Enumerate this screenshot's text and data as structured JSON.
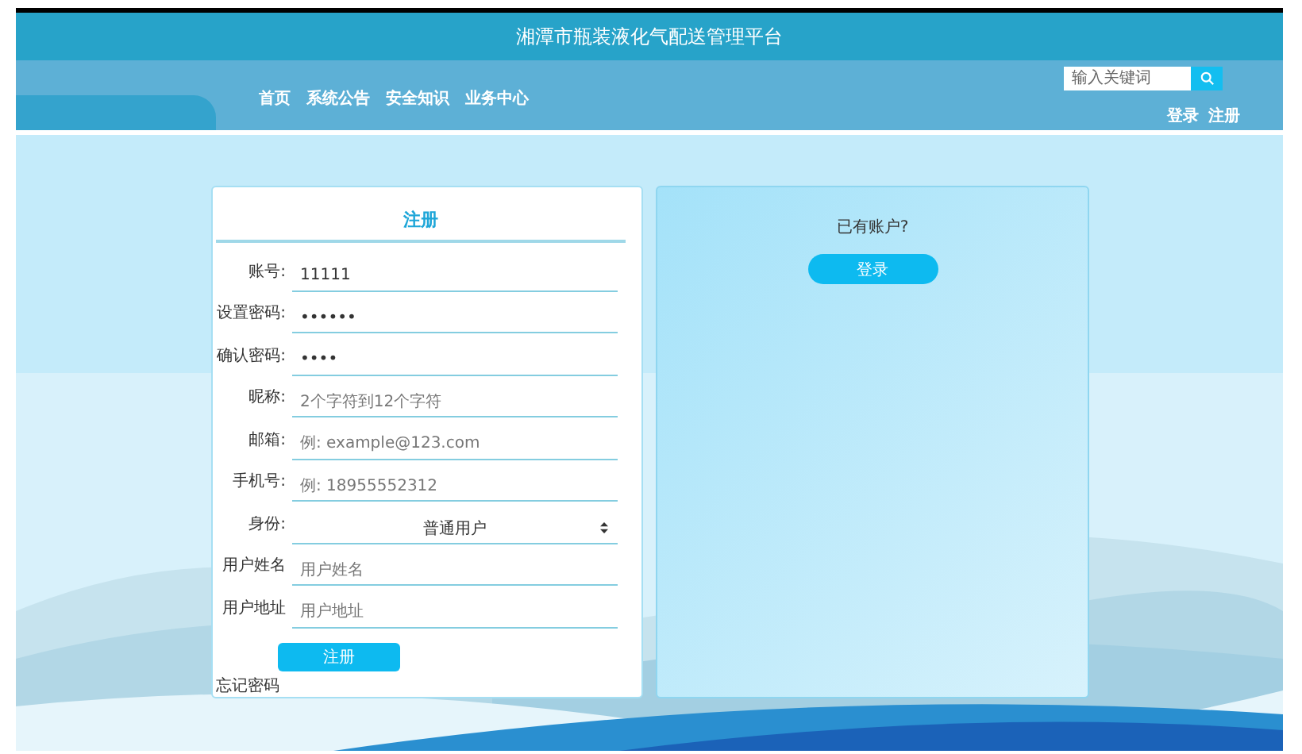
{
  "header": {
    "title": "湘潭市瓶装液化气配送管理平台"
  },
  "nav": [
    {
      "label": "首页"
    },
    {
      "label": "系统公告"
    },
    {
      "label": "安全知识"
    },
    {
      "label": "业务中心"
    }
  ],
  "search": {
    "placeholder": "输入关键词"
  },
  "account_links": [
    {
      "label": "登录"
    },
    {
      "label": "注册"
    }
  ],
  "register_form": {
    "title": "注册",
    "fields": [
      {
        "kind": "text",
        "label": "账号:",
        "value": "11111"
      },
      {
        "kind": "text",
        "label": "设置密码:",
        "value": "••••••"
      },
      {
        "kind": "text",
        "label": "确认密码:",
        "value": "••••"
      },
      {
        "kind": "text",
        "label": "昵称:",
        "placeholder": "2个字符到12个字符"
      },
      {
        "kind": "text",
        "label": "邮箱:",
        "placeholder": "例: example@123.com"
      },
      {
        "kind": "text",
        "label": "手机号:",
        "placeholder": "例: 18955552312"
      },
      {
        "kind": "select",
        "label": "身份:",
        "value": "普通用户"
      },
      {
        "kind": "text",
        "label": "用户姓名",
        "placeholder": "用户姓名"
      },
      {
        "kind": "text",
        "label": "用户地址",
        "placeholder": "用户地址"
      }
    ],
    "submit": "注册",
    "forgot": "忘记密码"
  },
  "login_panel": {
    "prompt": "已有账户?",
    "button": "登录"
  }
}
